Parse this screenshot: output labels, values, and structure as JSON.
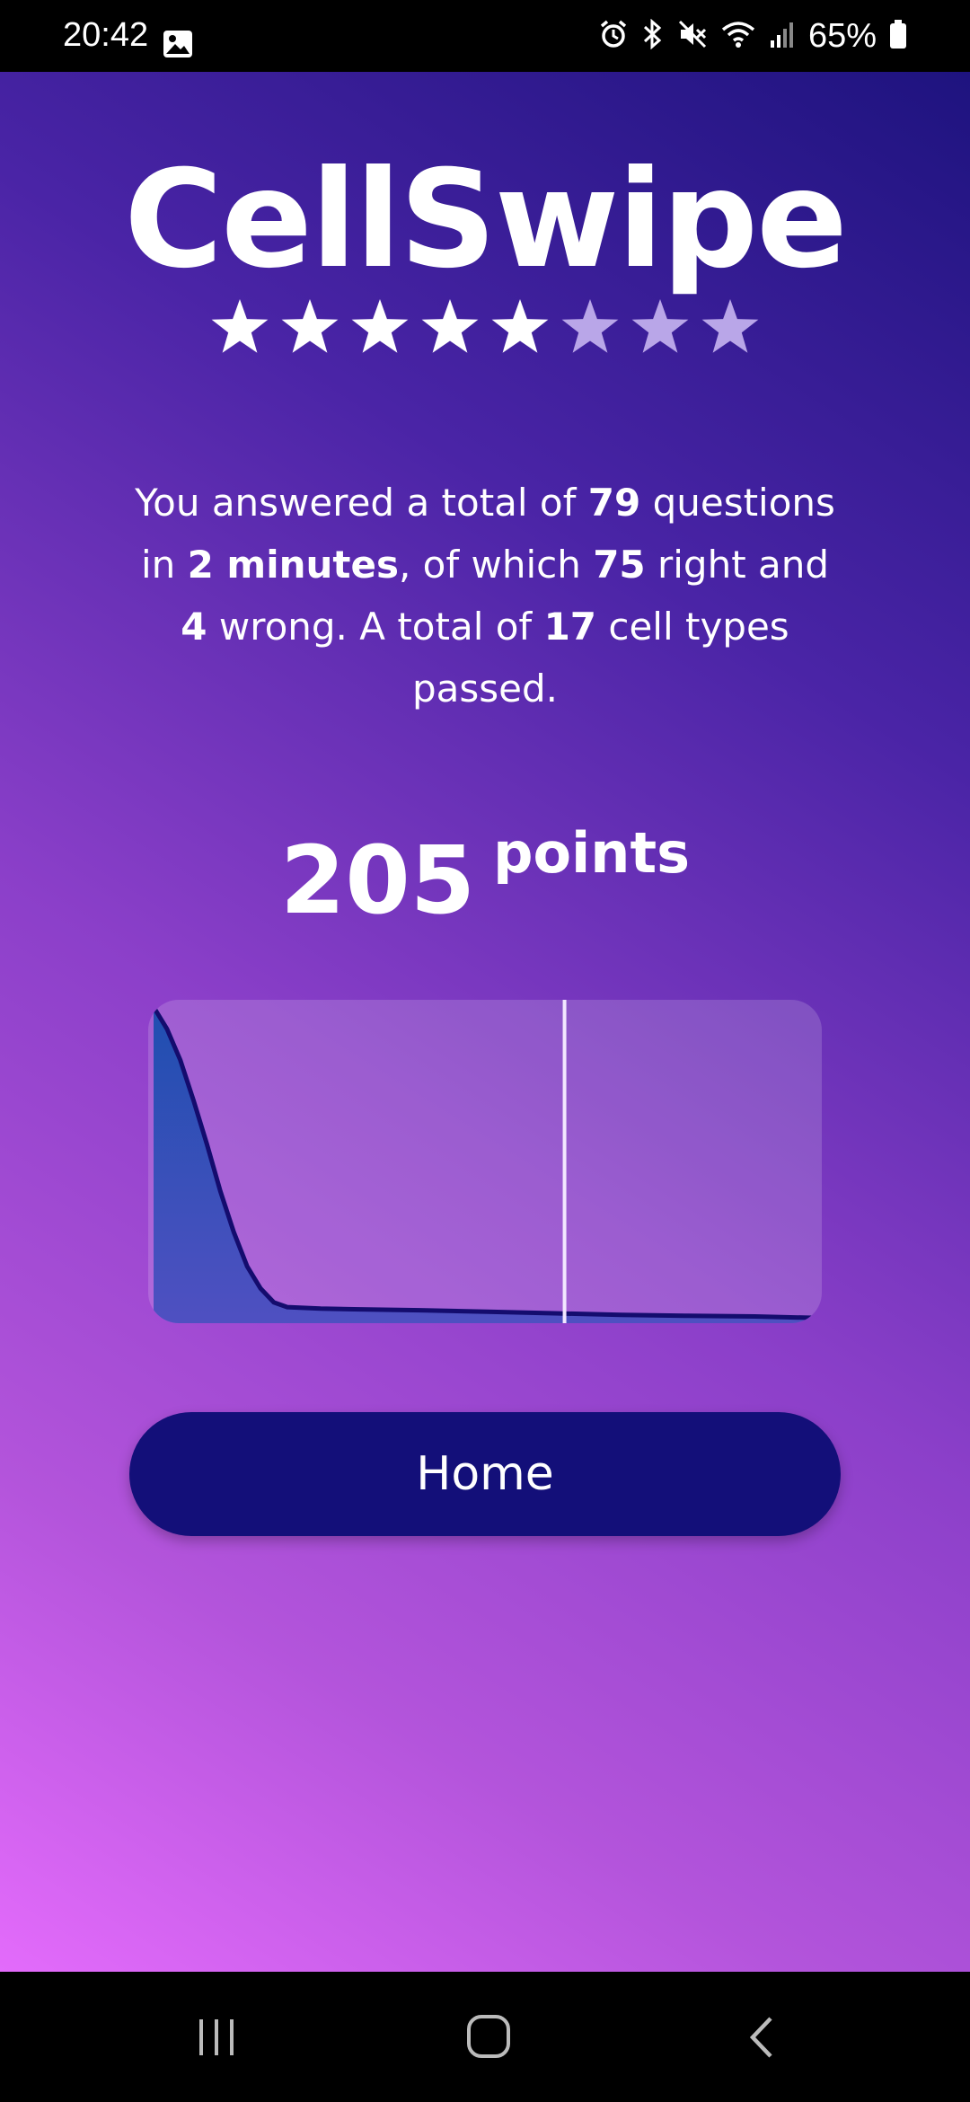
{
  "status_bar": {
    "time": "20:42",
    "battery_percent": "65%",
    "icons": [
      "gallery-icon",
      "alarm-icon",
      "bluetooth-icon",
      "mute-icon",
      "wifi-icon",
      "signal-icon",
      "battery-icon"
    ]
  },
  "app": {
    "title": "CellSwipe",
    "rating": {
      "filled": 5,
      "total": 8
    },
    "summary": {
      "p1": "You answered a total of ",
      "total_questions": "79",
      "p2": " questions in ",
      "duration": "2 minutes",
      "p3": ", of which ",
      "right": "75",
      "p4": " right and ",
      "wrong": "4",
      "p5": " wrong. A total of ",
      "cell_types": "17",
      "p6": " cell types passed."
    },
    "score": {
      "value": "205",
      "unit": "points"
    },
    "home_button_label": "Home"
  },
  "chart_data": {
    "type": "area",
    "x": [
      0,
      0.02,
      0.04,
      0.06,
      0.08,
      0.1,
      0.12,
      0.14,
      0.16,
      0.18,
      0.2,
      0.25,
      0.3,
      0.4,
      0.5,
      0.6,
      0.7,
      0.8,
      0.9,
      1.0
    ],
    "values": [
      1.0,
      0.93,
      0.83,
      0.7,
      0.56,
      0.41,
      0.28,
      0.17,
      0.1,
      0.055,
      0.04,
      0.035,
      0.033,
      0.03,
      0.025,
      0.02,
      0.015,
      0.012,
      0.01,
      0.005
    ],
    "marker_x": 0.615,
    "xlim": [
      0,
      1
    ],
    "ylim": [
      0,
      1
    ],
    "grid": false,
    "colors": {
      "fill": "#1f4fb0",
      "line": "#140c6e",
      "marker": "#f3e8ff"
    }
  },
  "theme": {
    "accent_dark": "#130f79",
    "star_filled": "#ffffff",
    "star_empty": "#b9a6e8"
  }
}
